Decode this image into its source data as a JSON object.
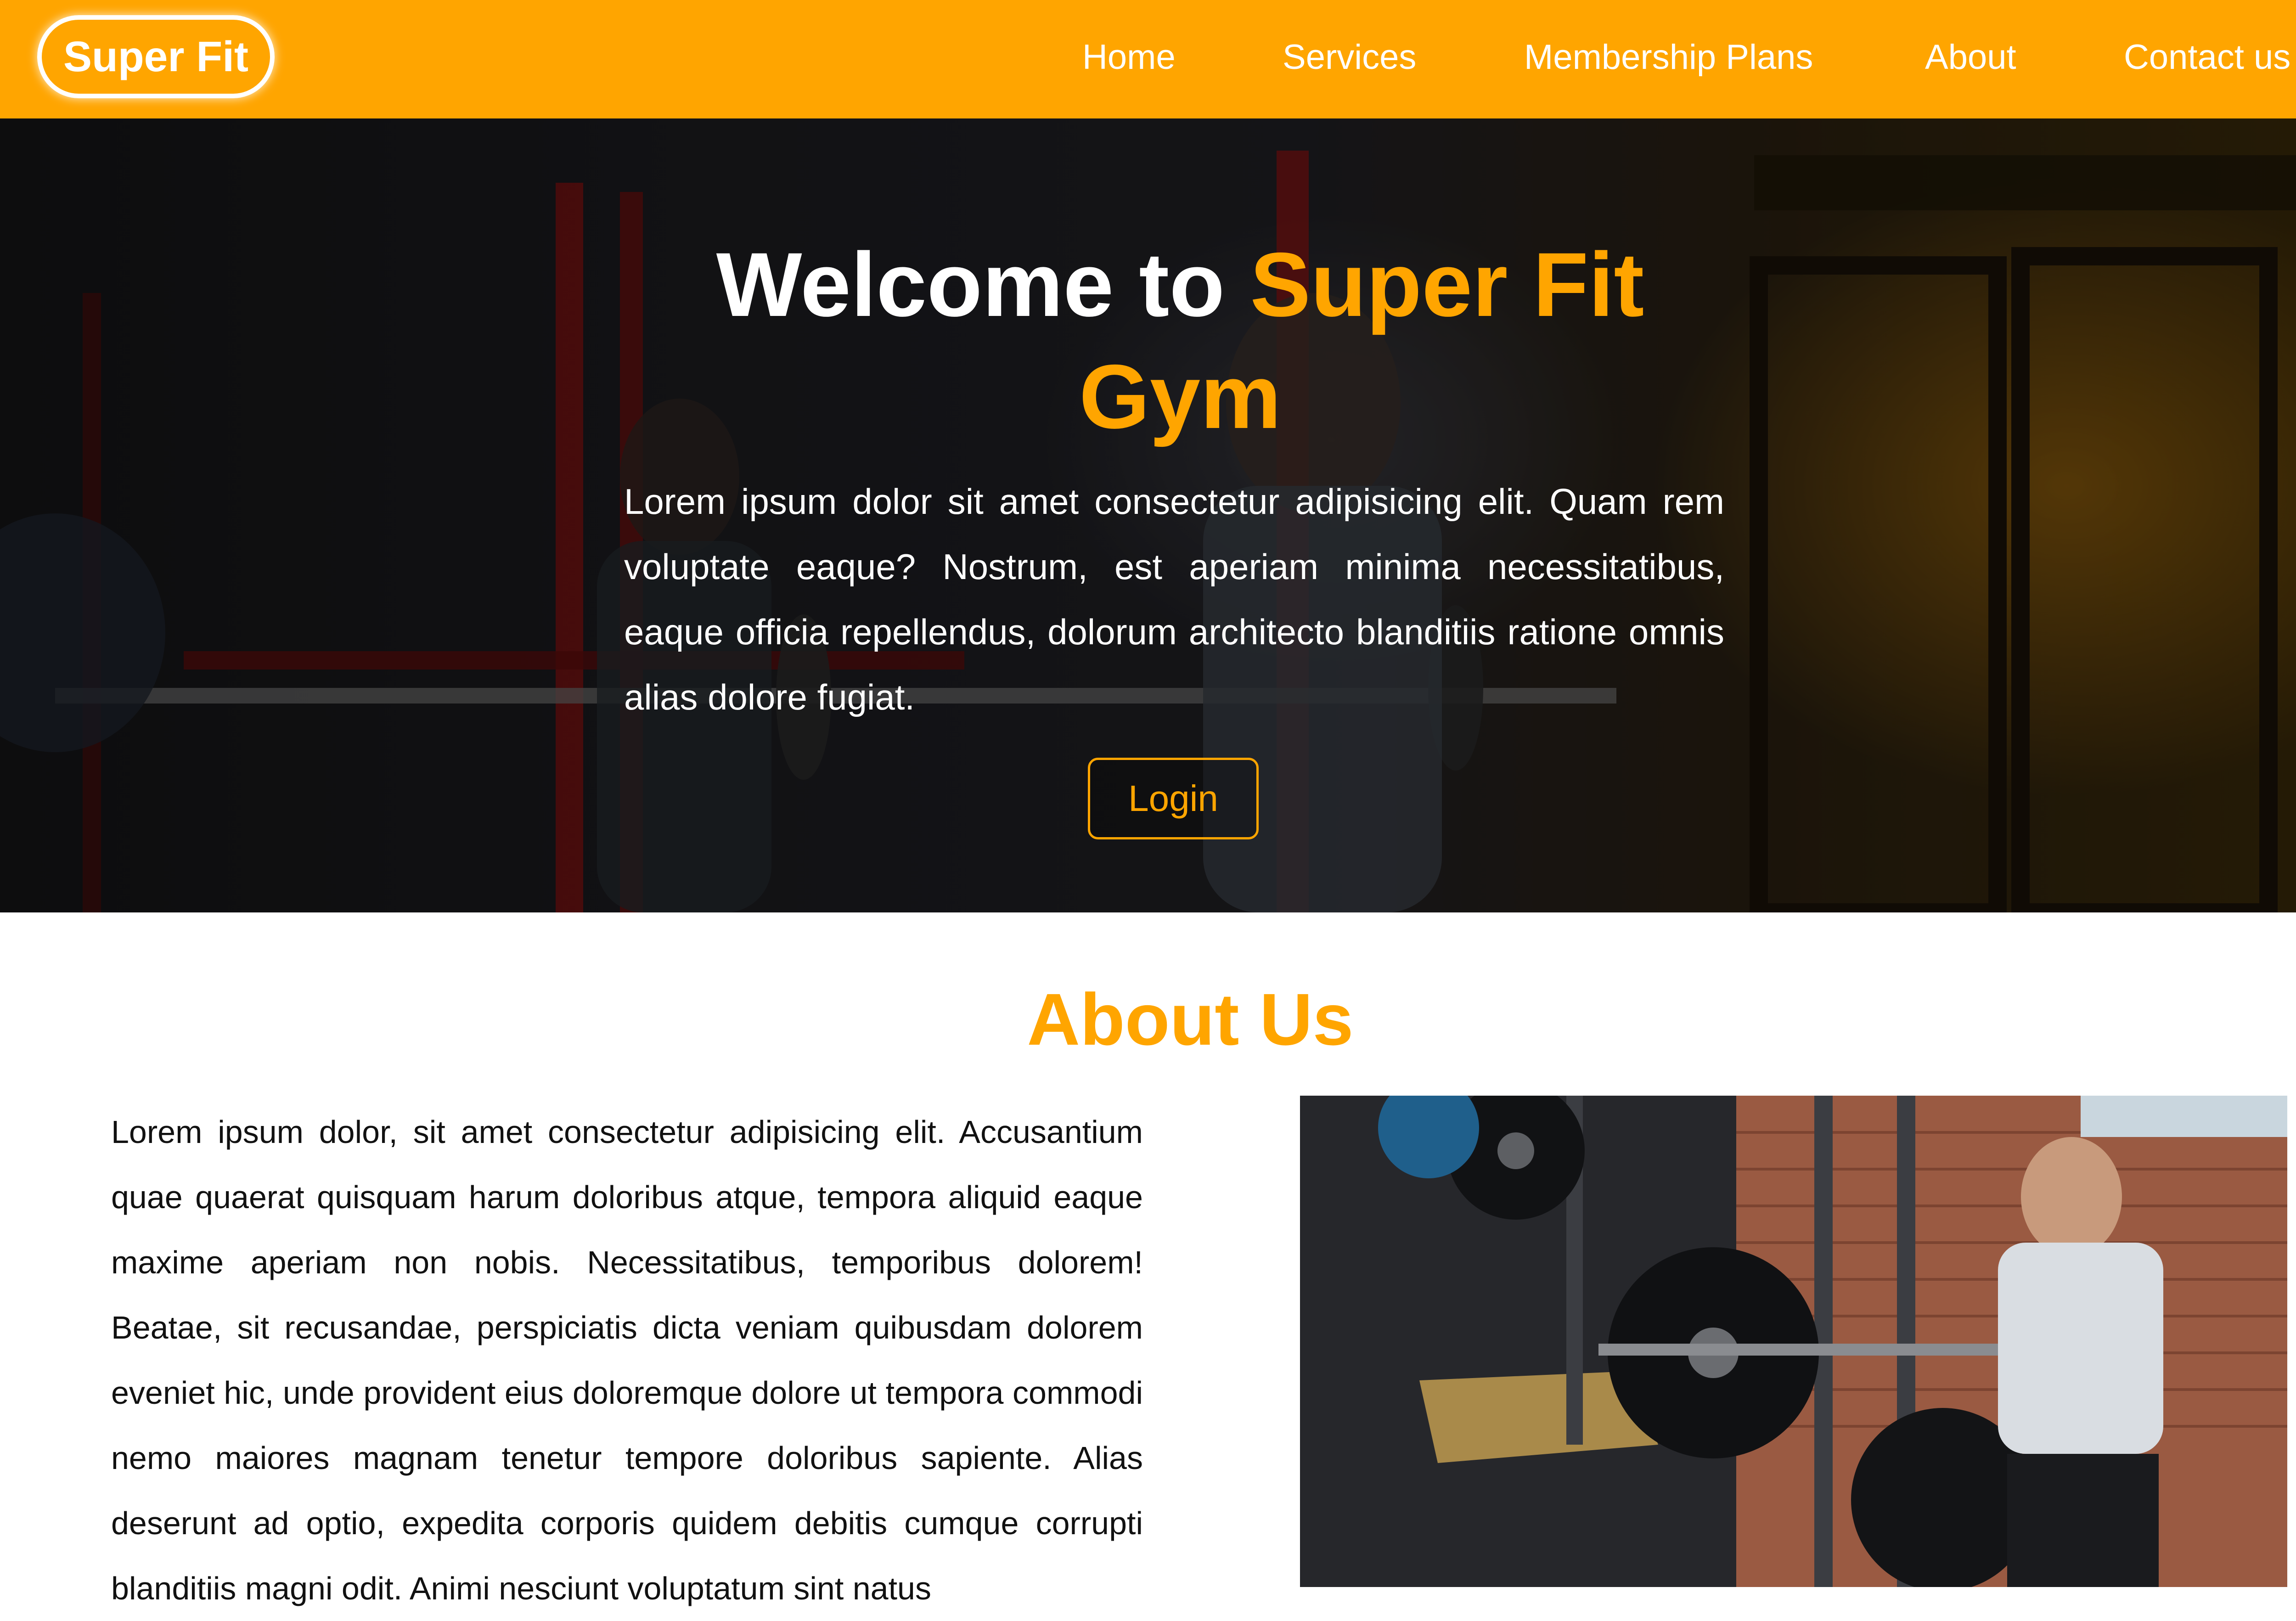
{
  "navbar": {
    "brand": "Super Fit",
    "links": [
      "Home",
      "Services",
      "Membership Plans",
      "About",
      "Contact us"
    ]
  },
  "hero": {
    "title_part1": "Welcome to ",
    "title_highlight": "Super Fit Gym",
    "paragraph": "Lorem ipsum dolor sit amet consectetur adipisicing elit. Quam rem voluptate eaque? Nostrum, est aperiam minima necessitatibus, eaque officia repellendus, dolorum architecto blanditiis ratione omnis alias dolore fugiat.",
    "login_button": "Login"
  },
  "about": {
    "title": "About Us",
    "paragraph": "Lorem ipsum dolor, sit amet consectetur adipisicing elit. Accusantium quae quaerat quisquam harum doloribus atque, tempora aliquid eaque maxime aperiam non nobis. Necessitatibus, temporibus dolorem! Beatae, sit recusandae, perspiciatis dicta veniam quibusdam dolorem eveniet hic, unde provident eius doloremque dolore ut tempora commodi nemo maiores magnam tenetur tempore doloribus sapiente. Alias deserunt ad optio, expedita corporis quidem debitis cumque corrupti blanditiis magni odit. Animi nesciunt voluptatum sint natus"
  },
  "colors": {
    "accent": "#ffa500",
    "nav_text": "#ffffff",
    "body_text": "#111111"
  }
}
